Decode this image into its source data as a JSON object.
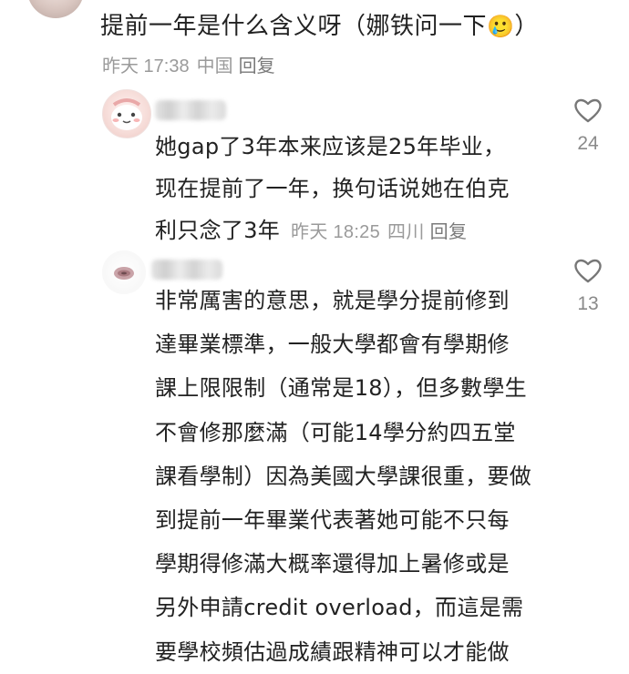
{
  "top_comment": {
    "text": "提前一年是什么含义呀（娜铁问一下",
    "emoji": "🥲",
    "text_close": "）",
    "time": "昨天 17:38",
    "location": "中国",
    "reply_label": "回复"
  },
  "replies": [
    {
      "lines": [
        "她gap了3年本来应该是25年毕业，",
        "现在提前了一年，换句话说她在伯克",
        "利只念了3年"
      ],
      "time": "昨天 18:25",
      "location": "四川",
      "reply_label": "回复",
      "likes": "24"
    },
    {
      "lines": [
        "非常厲害的意思，就是學分提前修到",
        "達畢業標準，一般大學都會有學期修",
        "課上限限制（通常是18），但多數學生",
        "不會修那麼滿（可能14學分約四五堂",
        "課看學制）因為美國大學課很重，要做",
        "到提前一年畢業代表著她可能不只每",
        "學期得修滿大概率還得加上暑修或是",
        "另外申請credit overload，而這是需",
        "要學校頻估過成績跟精神可以才能做"
      ],
      "likes": "13"
    }
  ],
  "colors": {
    "text": "#222222",
    "meta": "#9a9a9a",
    "heart": "#777777"
  },
  "icons": {
    "like": "heart-outline-icon"
  }
}
